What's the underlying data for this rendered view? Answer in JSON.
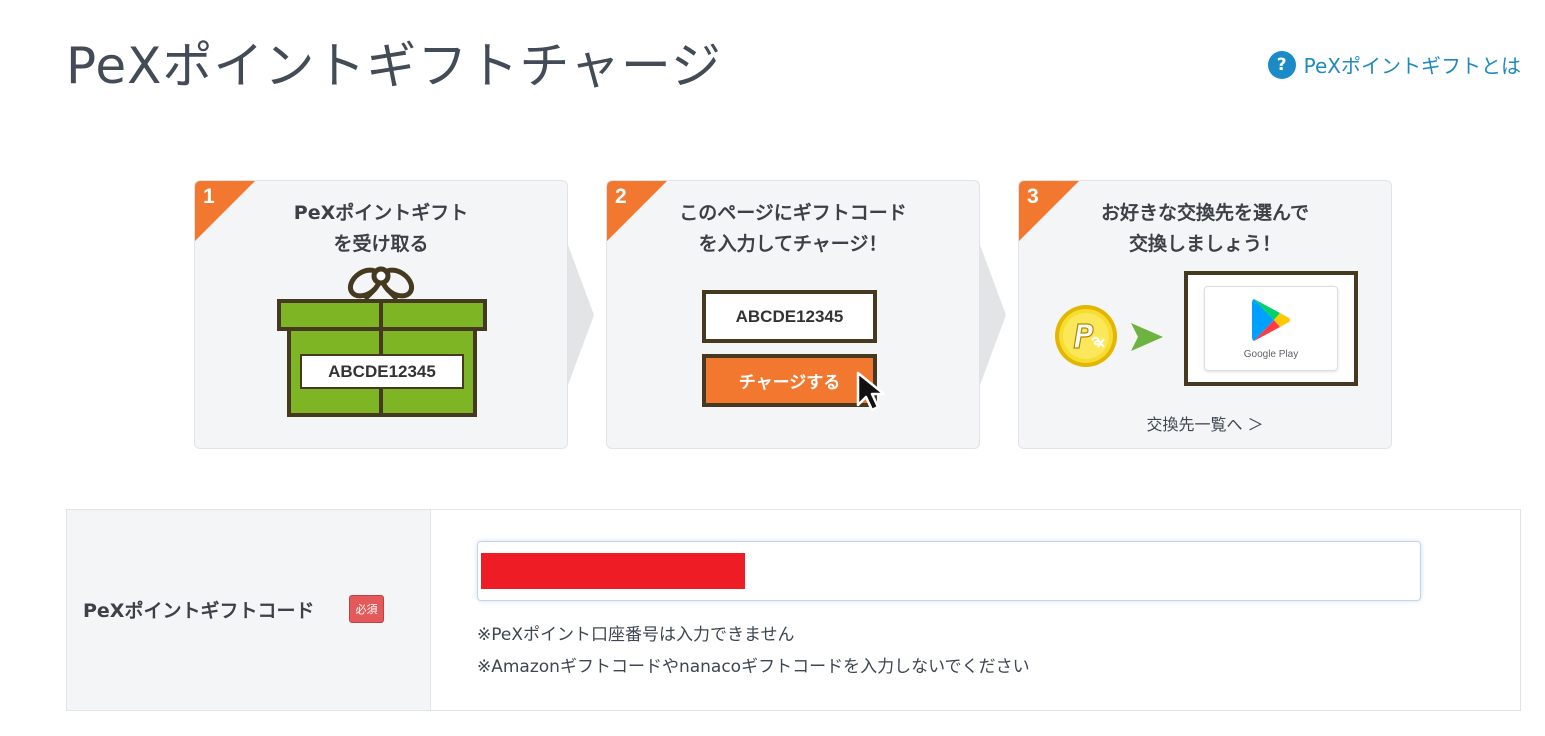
{
  "page": {
    "title": "PeXポイントギフトチャージ"
  },
  "help_link": {
    "icon": "?",
    "label": "PeXポイントギフトとは"
  },
  "steps": [
    {
      "number": "1",
      "title_lines": [
        "PeXポイントギフト",
        "を受け取る"
      ],
      "sample_code": "ABCDE12345"
    },
    {
      "number": "2",
      "title_lines": [
        "このページにギフトコード",
        "を入力してチャージ！"
      ],
      "sample_code": "ABCDE12345",
      "button_label": "チャージする"
    },
    {
      "number": "3",
      "title_lines": [
        "お好きな交換先を選んで",
        "交換しましょう！"
      ],
      "card_label": "Google Play",
      "link_label": "交換先一覧へ ＞"
    }
  ],
  "form": {
    "label": "PeXポイントギフトコード",
    "required_badge": "必須",
    "input_value": "",
    "notes": [
      "※PeXポイント口座番号は入力できません",
      "※Amazonギフトコードやnanacoギフトコードを入力しないでください"
    ]
  },
  "colors": {
    "accent_orange": "#f2782f",
    "gift_green": "#7db524",
    "link_blue": "#1f8ac0",
    "required_red": "#e45a5a",
    "redaction_red": "#ee1c24"
  }
}
